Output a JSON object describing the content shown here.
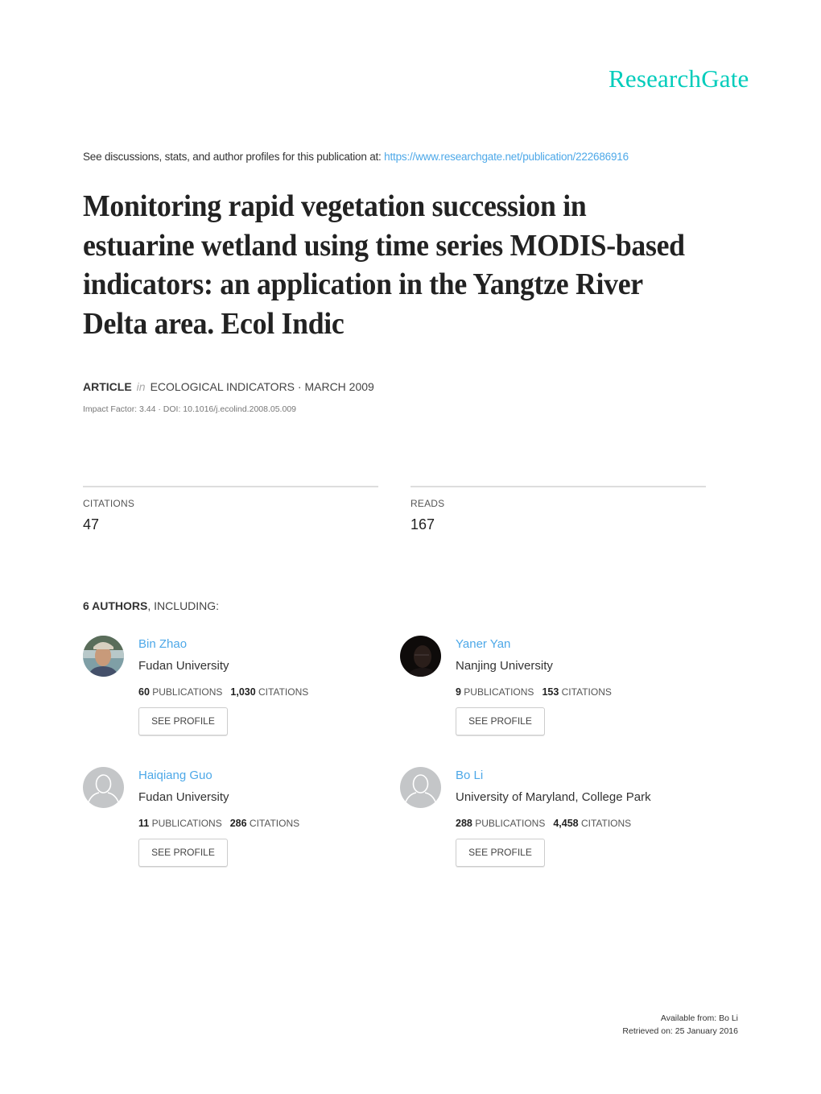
{
  "brand": {
    "logo_text": "ResearchGate",
    "accent_color": "#00ccbb",
    "link_color": "#4da8e8"
  },
  "header": {
    "see_text": "See discussions, stats, and author profiles for this publication at: ",
    "publication_url": "https://www.researchgate.net/publication/222686916"
  },
  "publication": {
    "title": "Monitoring rapid vegetation succession in estuarine wetland using time series MODIS-based indicators: an application in the Yangtze River Delta area. Ecol Indic",
    "type": "ARTICLE",
    "in_label": "in",
    "journal_date": "ECOLOGICAL INDICATORS · MARCH 2009",
    "impact_doi": "Impact Factor: 3.44 · DOI: 10.1016/j.ecolind.2008.05.009"
  },
  "stats": {
    "citations": {
      "label": "CITATIONS",
      "value": "47"
    },
    "reads": {
      "label": "READS",
      "value": "167"
    }
  },
  "authors_section": {
    "count_label": "6 AUTHORS",
    "suffix": ", INCLUDING:"
  },
  "authors": [
    {
      "name": "Bin Zhao",
      "institution": "Fudan University",
      "publications": "60",
      "citations": "1,030",
      "avatar": "photo",
      "button": "SEE PROFILE"
    },
    {
      "name": "Yaner Yan",
      "institution": "Nanjing University",
      "publications": "9",
      "citations": "153",
      "avatar": "photo-dark",
      "button": "SEE PROFILE"
    },
    {
      "name": "Haiqiang Guo",
      "institution": "Fudan University",
      "publications": "11",
      "citations": "286",
      "avatar": "placeholder",
      "button": "SEE PROFILE"
    },
    {
      "name": "Bo Li",
      "institution": "University of Maryland, College Park",
      "publications": "288",
      "citations": "4,458",
      "avatar": "placeholder",
      "button": "SEE PROFILE"
    }
  ],
  "labels": {
    "publications": "PUBLICATIONS",
    "citations": "CITATIONS"
  },
  "footer": {
    "available_from": "Available from: Bo Li",
    "retrieved_on": "Retrieved on: 25 January 2016"
  }
}
